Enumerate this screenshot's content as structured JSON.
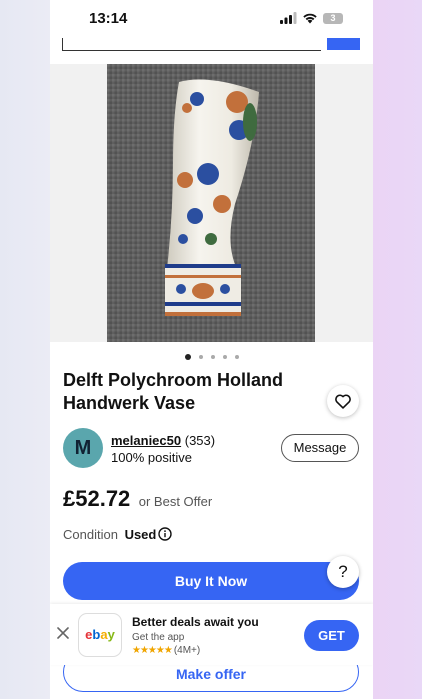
{
  "status_bar": {
    "time": "13:14",
    "battery": "3"
  },
  "carousel": {
    "dots_total": 5,
    "active_index": 0
  },
  "listing": {
    "title": "Delft Polychroom Holland Handwerk Vase",
    "price": "£52.72",
    "price_note": "or Best Offer",
    "condition_label": "Condition",
    "condition_value": "Used"
  },
  "seller": {
    "initial": "M",
    "name": "melaniec50",
    "feedback_count": "(353)",
    "positive": "100% positive",
    "avatar_color": "#5aa6ad"
  },
  "actions": {
    "message": "Message",
    "buy_now": "Buy It Now",
    "make_offer": "Make offer",
    "help": "?"
  },
  "app_banner": {
    "title": "Better deals await you",
    "subtitle": "Get the app",
    "rating_stars": "★★★★★",
    "rating_count": "(4M+)",
    "cta": "GET",
    "app_name": "ebay"
  },
  "icons": [
    "heart-icon",
    "info-icon",
    "close-icon",
    "signal-icon",
    "wifi-icon",
    "battery-icon"
  ],
  "colors": {
    "accent": "#3665f3",
    "ebay_e": "#e53238",
    "ebay_b": "#0064d2",
    "ebay_a": "#f5af02",
    "ebay_y": "#86b817"
  }
}
